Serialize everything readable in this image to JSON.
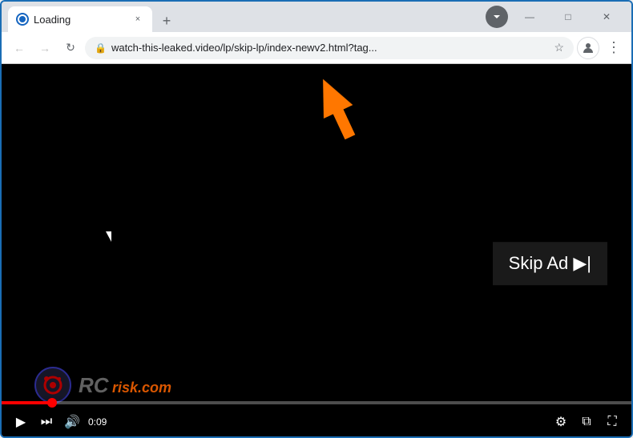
{
  "browser": {
    "tab": {
      "favicon_label": "globe",
      "title": "Loading",
      "close_label": "×"
    },
    "new_tab_label": "+",
    "window_controls": {
      "minimize": "—",
      "maximize": "□",
      "close": "✕"
    },
    "address_bar": {
      "back_label": "←",
      "forward_label": "→",
      "refresh_label": "↻",
      "url": "watch-this-leaked.video/lp/skip-lp/index-newv2.html?tag...",
      "lock_icon": "🔒",
      "star_icon": "☆",
      "profile_icon": "👤",
      "menu_icon": "⋮",
      "extensions_icon": "▼"
    }
  },
  "video": {
    "skip_ad_label": "Skip Ad ▶|",
    "time_current": "0:09",
    "time_total": "",
    "progress_percent": 8,
    "watermark_text": "RC",
    "watermark_domain": "risk.com",
    "controls": {
      "play_icon": "▶",
      "next_icon": "⏭",
      "volume_icon": "🔊",
      "settings_icon": "⚙",
      "miniplayer_icon": "⧉",
      "fullscreen_icon": "⛶"
    }
  },
  "arrow": {
    "color": "#ff7700"
  }
}
